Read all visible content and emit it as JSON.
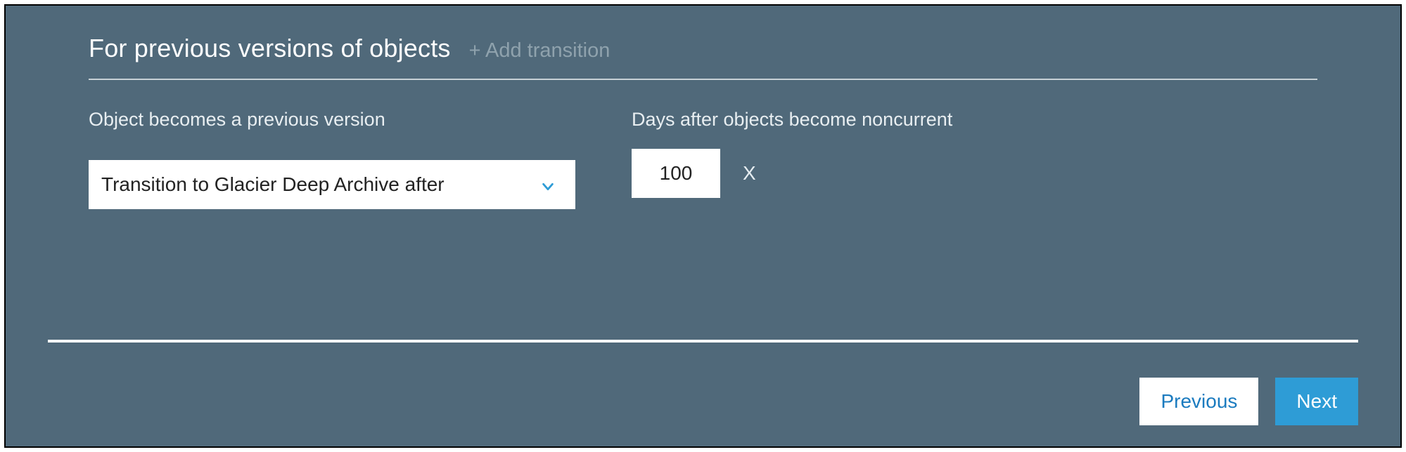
{
  "section": {
    "title": "For previous versions of objects",
    "add_transition_label": "+ Add transition"
  },
  "fields": {
    "transition": {
      "label": "Object becomes a previous version",
      "selected": "Transition to Glacier Deep Archive after"
    },
    "days": {
      "label": "Days after objects become noncurrent",
      "value": "100",
      "remove_label": "X"
    }
  },
  "footer": {
    "previous_label": "Previous",
    "next_label": "Next"
  },
  "colors": {
    "panel_bg": "#50697a",
    "accent": "#2e9cd6",
    "link": "#1b7bbf"
  }
}
